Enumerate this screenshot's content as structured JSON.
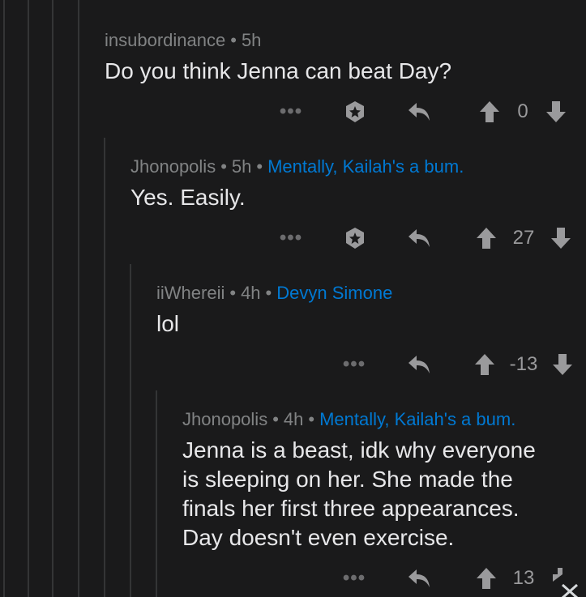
{
  "comments": [
    {
      "author": "insubordinance",
      "time": "5h",
      "flair": "",
      "body": "Do you think Jenna can beat Day?",
      "score": "0",
      "more": "•••"
    },
    {
      "author": "Jhonopolis",
      "time": "5h",
      "flair": "Mentally, Kailah's a bum.",
      "body": "Yes. Easily.",
      "score": "27",
      "more": "•••"
    },
    {
      "author": "iiWhereii",
      "time": "4h",
      "flair": "Devyn Simone",
      "body": "lol",
      "score": "-13",
      "more": "•••"
    },
    {
      "author": "Jhonopolis",
      "time": "4h",
      "flair": "Mentally, Kailah's a bum.",
      "body_lines": [
        "Jenna is a beast, idk why everyone",
        "is sleeping on her. She made the",
        "finals her first three appearances.",
        "Day doesn't even exercise."
      ],
      "score": "13",
      "more": "•••"
    }
  ],
  "separator": "•",
  "colors": {
    "background": "#1a1a1b",
    "text": "#e7e7e9",
    "meta": "#818384",
    "flair": "#0079d3",
    "thread_line": "#343536"
  }
}
